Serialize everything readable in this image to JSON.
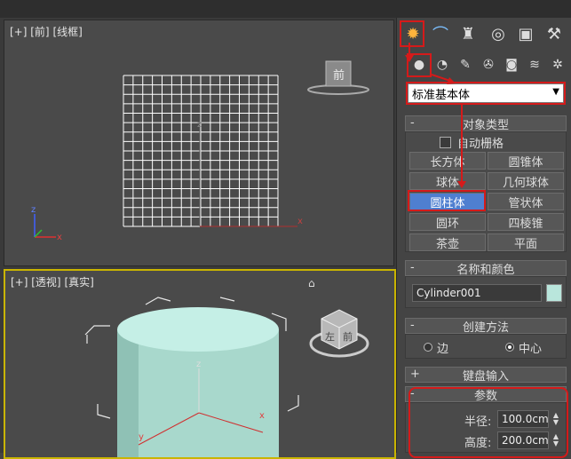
{
  "viewports": {
    "front": {
      "label_plus": "[+]",
      "label_view": "[前]",
      "label_mode": "[线框]",
      "cube_label": "前"
    },
    "persp": {
      "label_plus": "[+]",
      "label_view": "[透视]",
      "label_mode": "[真实]",
      "cube_left": "左",
      "cube_right": "前"
    }
  },
  "axes": {
    "x": "x",
    "y": "y",
    "z": "z"
  },
  "panel": {
    "dropdown_value": "标准基本体",
    "object_type": {
      "title": "对象类型",
      "collapse": "-",
      "autogrid": "自动栅格",
      "buttons": [
        "长方体",
        "圆锥体",
        "球体",
        "几何球体",
        "圆柱体",
        "管状体",
        "圆环",
        "四棱锥",
        "茶壶",
        "平面"
      ],
      "active": "圆柱体"
    },
    "name_color": {
      "title": "名称和颜色",
      "collapse": "-",
      "name_value": "Cylinder001",
      "color": "#b9e6dc"
    },
    "creation": {
      "title": "创建方法",
      "collapse": "-",
      "edge": "边",
      "center": "中心",
      "selected": "中心"
    },
    "keyboard": {
      "title": "键盘输入",
      "collapse": "+"
    },
    "params": {
      "title": "参数",
      "collapse": "-",
      "radius_label": "半径:",
      "radius_value": "100.0cm",
      "height_label": "高度:",
      "height_value": "200.0cm"
    }
  },
  "colors": {
    "highlight": "#d51a1a",
    "active_button": "#4f7fd0",
    "viewport_border": "#c9b400"
  }
}
